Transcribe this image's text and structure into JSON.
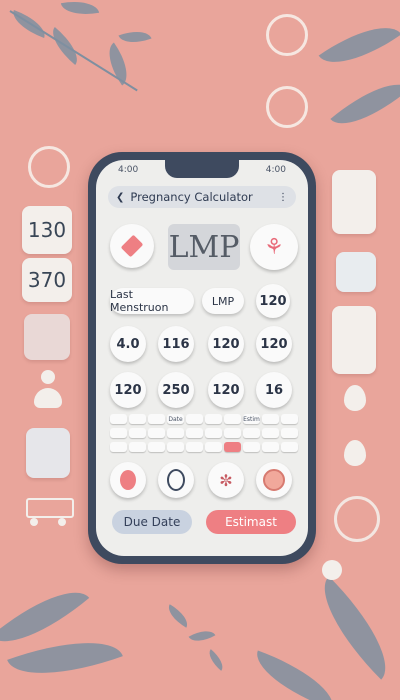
{
  "phone": {
    "status_left": "4:00",
    "status_right": "4:00",
    "title": "Pregnancy Calculator",
    "lmp_label": "LMP",
    "last_menstruation_label": "Last Menstruon",
    "lmp_chip": "LMP",
    "row_1": [
      "120"
    ],
    "row_2": [
      "4.0",
      "116",
      "120",
      "120"
    ],
    "row_3": [
      "120",
      "250",
      "120",
      "16"
    ],
    "keypad_row_1": [
      "",
      "",
      "",
      "Date",
      "",
      "",
      "",
      "Estim",
      "",
      ""
    ],
    "due_date_label": "Due Date",
    "estimate_label": "Estimast"
  },
  "side_cards": {
    "left_card_1": "130",
    "left_card_2": "370"
  },
  "colors": {
    "background": "#e9a59b",
    "phone_frame": "#3e4a5f",
    "screen": "#eeeeec",
    "accent_pink": "#ee7f83",
    "due_date_button": "#c9d2e0"
  }
}
